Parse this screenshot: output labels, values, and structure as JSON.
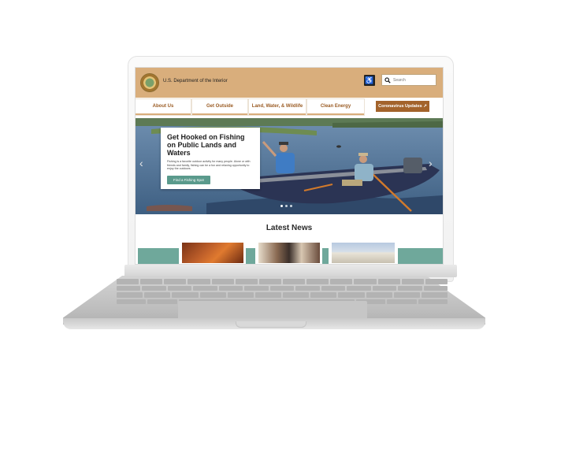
{
  "site": {
    "agency_name": "U.S. Department of the Interior",
    "search": {
      "placeholder": "Search"
    },
    "accessibility_icon": "wheelchair-icon"
  },
  "nav": {
    "items": [
      {
        "label": "About Us"
      },
      {
        "label": "Get Outside"
      },
      {
        "label": "Land, Water, & Wildlife"
      },
      {
        "label": "Clean Energy"
      }
    ],
    "covid_button": "Coronavirus Updates"
  },
  "hero": {
    "title": "Get Hooked on Fishing on Public Lands and Waters",
    "text": "Fishing is a favorite outdoor activity for many people. Alone or with friends and family, fishing can be a fun and relaxing opportunity to enjoy the outdoors.",
    "cta": "Find a Fishing Spot",
    "active_slide": 1,
    "slide_count": 3
  },
  "news": {
    "heading": "Latest News"
  },
  "colors": {
    "header_bg": "#d9ae7c",
    "nav_text": "#9a5b23",
    "covid_button": "#a3632b",
    "cta_button": "#5a9a8c",
    "teal_band": "#6fa89b"
  }
}
